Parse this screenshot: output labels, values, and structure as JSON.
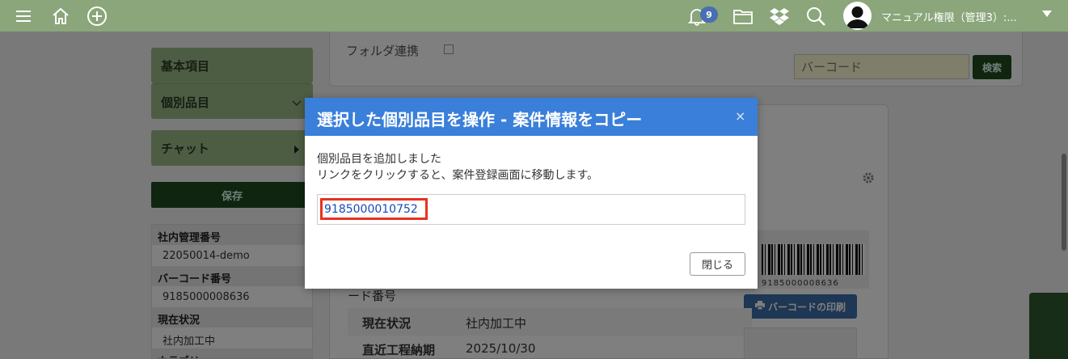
{
  "topbar": {
    "notification_count": "9",
    "user_name": "マニュアル権限（管理3）:..."
  },
  "sidebar": {
    "basic_items": "基本項目",
    "individual_items": "個別品目",
    "chat": "チャット",
    "save": "保存",
    "info": [
      {
        "label": "社内管理番号",
        "value": "22050014-demo"
      },
      {
        "label": "バーコード番号",
        "value": "9185000008636"
      },
      {
        "label": "現在状況",
        "value": "社内加工中"
      },
      {
        "label": "カテゴリー",
        "value": ""
      }
    ]
  },
  "main": {
    "folder_link_label": "フォルダ連携",
    "barcode_placeholder": "バーコード",
    "search_button": "検索",
    "barcode_number_partial": "ード番号",
    "barcode_image_number": "9185000008636",
    "print_button": "バーコードの印刷",
    "details": [
      {
        "label": "現在状況",
        "value": "社内加工中"
      },
      {
        "label": "直近工程納期",
        "value": "2025/10/30"
      }
    ]
  },
  "modal": {
    "title": "選択した個別品目を操作 - 案件情報をコピー",
    "close_x": "×",
    "message_line1": "個別品目を追加しました",
    "message_line2": "リンクをクリックすると、案件登録画面に移動します。",
    "link_text": "9185000010752",
    "close_button": "閉じる"
  }
}
